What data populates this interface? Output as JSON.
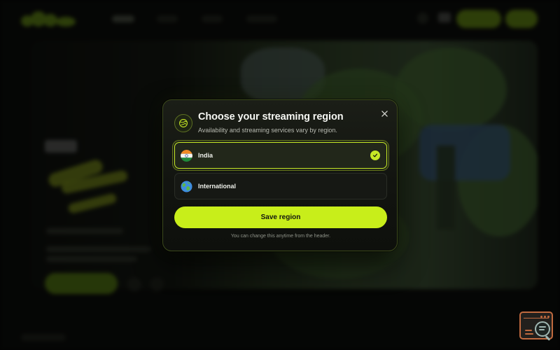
{
  "modal": {
    "title": "Choose your streaming region",
    "subtitle": "Availability and streaming services vary by region.",
    "header_icon": "globe-icon",
    "close_icon": "close-icon",
    "options": [
      {
        "label": "India",
        "flag": "india-flag-icon",
        "selected": true
      },
      {
        "label": "International",
        "flag": "globe-earth-icon",
        "selected": false
      }
    ],
    "save_label": "Save region",
    "footnote": "You can change this anytime from the header."
  },
  "colors": {
    "accent": "#c8ee1a",
    "modal_bg": "#15180f",
    "page_bg": "#050605"
  },
  "floating_widget": {
    "icon": "terminal-search-icon"
  }
}
